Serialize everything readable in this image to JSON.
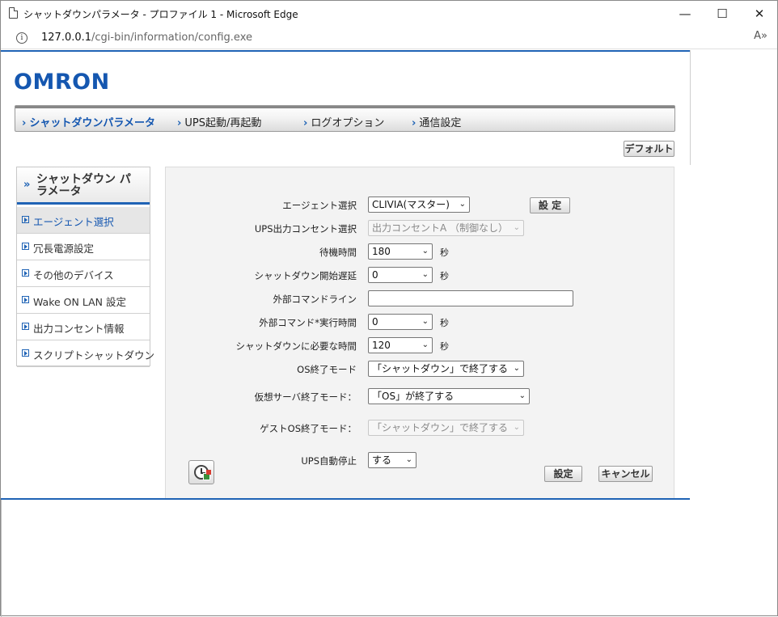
{
  "window": {
    "title": "シャットダウンパラメータ - プロファイル 1 - Microsoft Edge",
    "minimize": "—",
    "maximize": "☐",
    "close": "✕"
  },
  "address": {
    "host": "127.0.0.1",
    "path": "/cgi-bin/information/config.exe",
    "read_aloud": "A»"
  },
  "brand": {
    "logo": "OMRON",
    "color": "#1557b0"
  },
  "nav": [
    {
      "label": "シャットダウンパラメータ",
      "active": true
    },
    {
      "label": "UPS起動/再起動",
      "active": false
    },
    {
      "label": "ログオプション",
      "active": false
    },
    {
      "label": "通信設定",
      "active": false
    }
  ],
  "default_button": "デフォルト",
  "sidebar": {
    "title": "シャットダウン パラメータ",
    "items": [
      {
        "label": "エージェント選択",
        "active": true
      },
      {
        "label": "冗長電源設定",
        "active": false
      },
      {
        "label": "その他のデバイス",
        "active": false
      },
      {
        "label": "Wake ON LAN 設定",
        "active": false
      },
      {
        "label": "出力コンセント情報",
        "active": false
      },
      {
        "label": "スクリプトシャットダウン",
        "active": false
      }
    ]
  },
  "form": {
    "agent": {
      "label": "エージェント選択",
      "value": "CLIVIA(マスター)",
      "set_button": "設 定"
    },
    "outlet": {
      "label": "UPS出力コンセント選択",
      "value": "出力コンセントA （制御なし）",
      "disabled": true
    },
    "wait_time": {
      "label": "待機時間",
      "value": "180",
      "unit": "秒"
    },
    "shutdown_delay": {
      "label": "シャットダウン開始遅延",
      "value": "0",
      "unit": "秒"
    },
    "external_cmd": {
      "label": "外部コマンドライン",
      "value": ""
    },
    "external_cmd_time": {
      "label": "外部コマンド*実行時間",
      "value": "0",
      "unit": "秒"
    },
    "shutdown_required_time": {
      "label": "シャットダウンに必要な時間",
      "value": "120",
      "unit": "秒"
    },
    "os_mode": {
      "label": "OS終了モード",
      "value": "「シャットダウン」で終了する"
    },
    "vm_server_mode": {
      "label": "仮想サーバ終了モード：",
      "value": "「OS」が終了する"
    },
    "guest_os_mode": {
      "label": "ゲストOS終了モード：",
      "value": "「シャットダウン」で終了する",
      "disabled": true
    },
    "ups_auto_stop": {
      "label": "UPS自動停止",
      "value": "する"
    },
    "save_button": "設定",
    "cancel_button": "キャンセル"
  }
}
